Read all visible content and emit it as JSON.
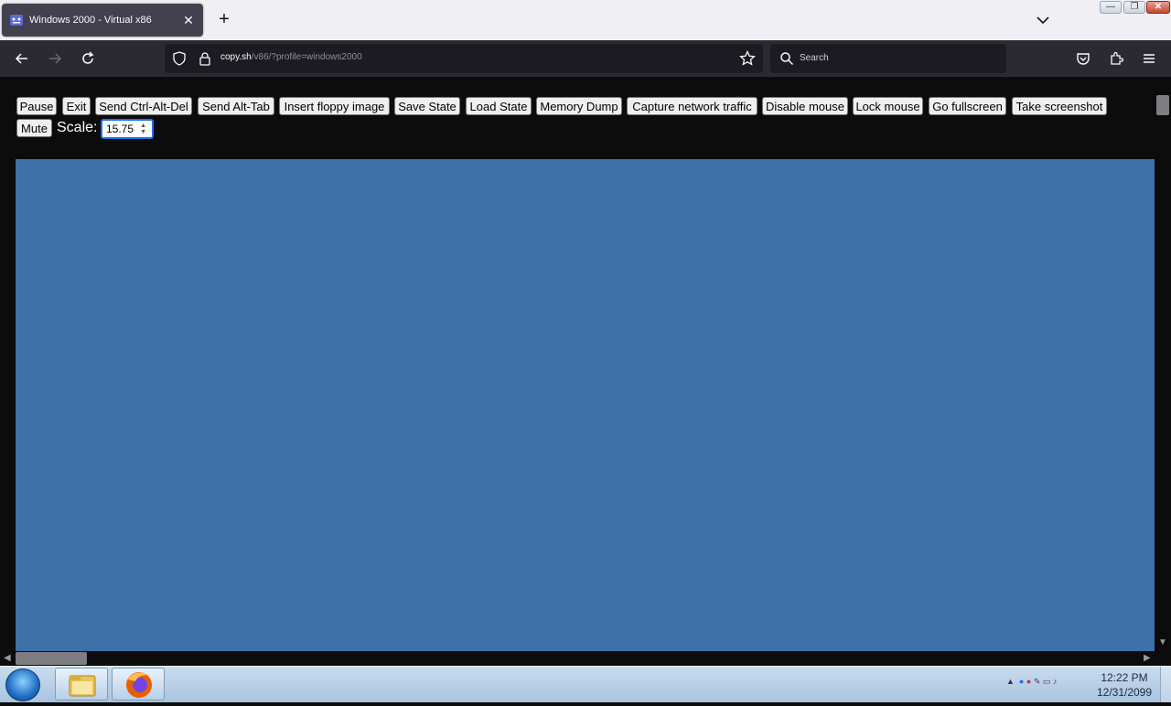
{
  "browser": {
    "tab": {
      "title": "Windows 2000 - Virtual x86",
      "close_glyph": "✕"
    },
    "newtab_glyph": "+",
    "url": {
      "host": "copy.sh",
      "path": "/v86/?profile=windows2000"
    },
    "search_placeholder": "Search"
  },
  "toolbar": {
    "buttons": [
      "Pause",
      "Exit",
      "Send Ctrl-Alt-Del",
      "Send Alt-Tab",
      "Insert floppy image",
      "Save State",
      "Load State",
      "Memory Dump",
      "Capture network traffic",
      "Disable mouse",
      "Lock mouse",
      "Go fullscreen",
      "Take screenshot"
    ],
    "mute": "Mute",
    "scale_label": "Scale:",
    "scale_value": "15.75"
  },
  "screen": {
    "color": "#3d71a8"
  },
  "taskbar": {
    "time": "12:22 PM",
    "date": "12/31/2099"
  },
  "colors": {
    "accent": "#1a73e8",
    "page_bg": "#0c0c0d",
    "tab_bg": "#42414d"
  }
}
